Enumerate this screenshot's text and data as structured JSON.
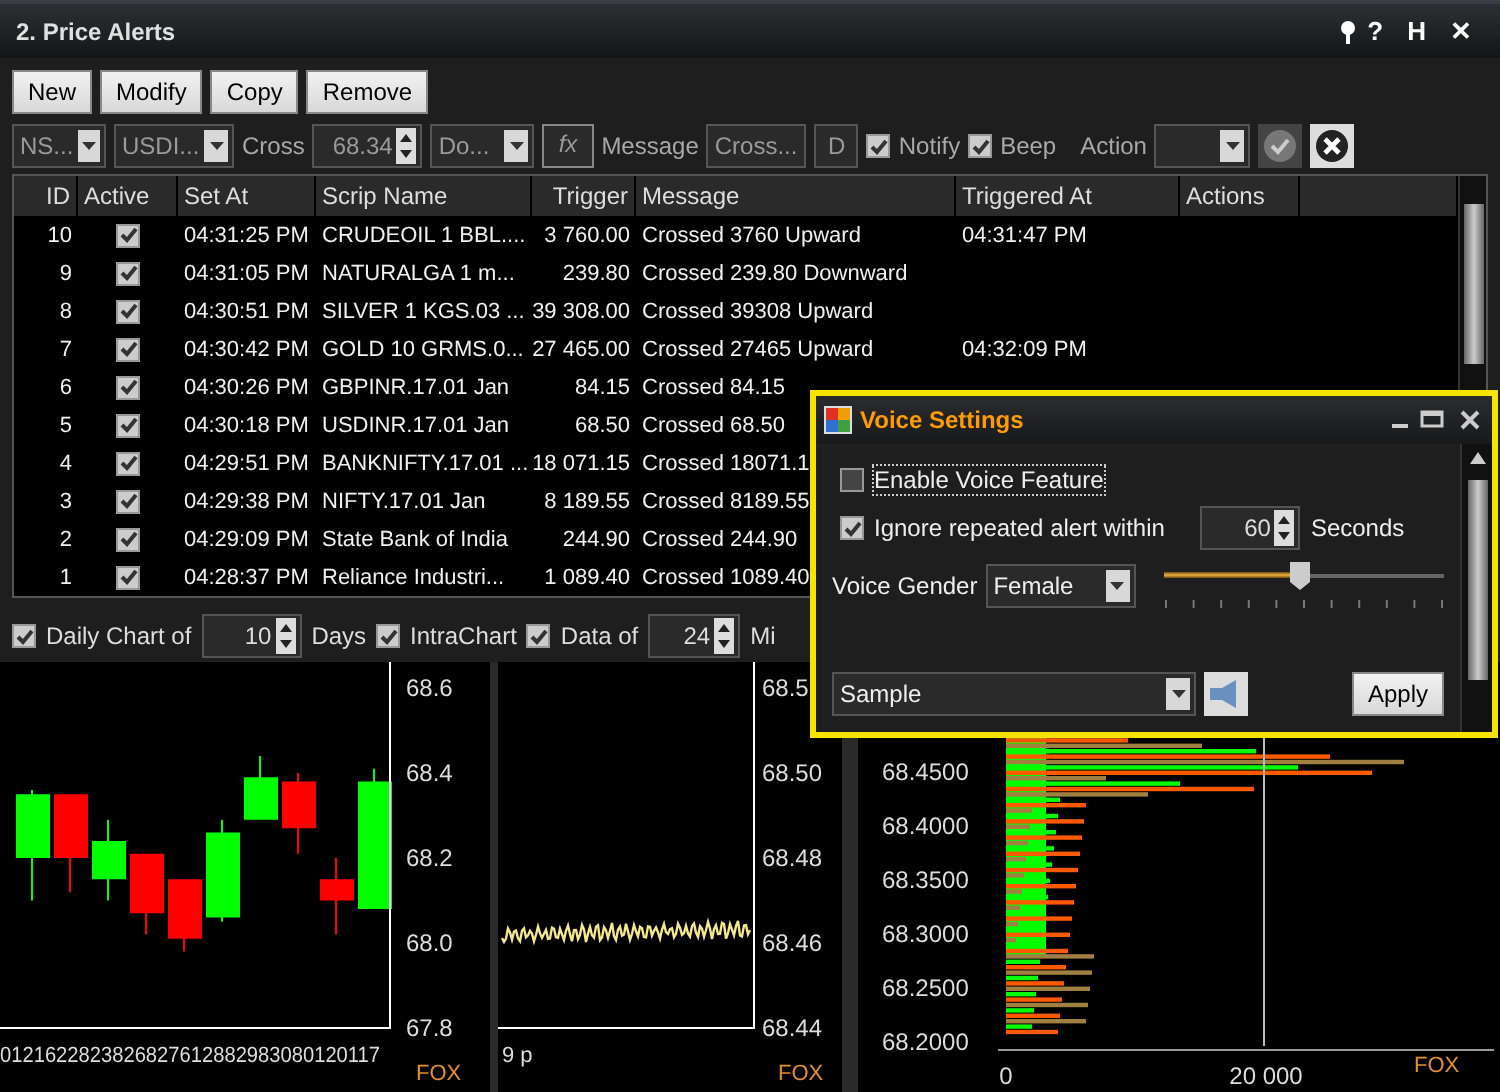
{
  "window": {
    "title": "2. Price Alerts",
    "title_buttons": [
      "?",
      "H",
      "✕"
    ]
  },
  "toolbar": {
    "buttons": [
      "New",
      "Modify",
      "Copy",
      "Remove"
    ]
  },
  "filter": {
    "exchange": "NS...",
    "symbol": "USDI...",
    "condition": "Cross",
    "price": "68.34",
    "direction": "Do...",
    "fx": "fx",
    "message_label": "Message",
    "message": "Cross...",
    "d": "D",
    "notify": {
      "label": "Notify",
      "checked": true
    },
    "beep": {
      "label": "Beep",
      "checked": true
    },
    "action_label": "Action"
  },
  "table": {
    "columns": [
      "ID",
      "Active",
      "Set At",
      "Scrip Name",
      "Trigger",
      "Message",
      "Triggered At",
      "Actions"
    ],
    "rows": [
      {
        "id": "10",
        "active": true,
        "set_at": "04:31:25 PM",
        "scrip": "CRUDEOIL 1 BBL....",
        "trigger": "3 760.00",
        "message": "Crossed 3760 Upward",
        "triggered_at": "04:31:47 PM"
      },
      {
        "id": "9",
        "active": true,
        "set_at": "04:31:05 PM",
        "scrip": "NATURALGA 1 m...",
        "trigger": "239.80",
        "message": "Crossed 239.80 Downward"
      },
      {
        "id": "8",
        "active": true,
        "set_at": "04:30:51 PM",
        "scrip": "SILVER 1 KGS.03 ...",
        "trigger": "39 308.00",
        "message": "Crossed 39308 Upward"
      },
      {
        "id": "7",
        "active": true,
        "set_at": "04:30:42 PM",
        "scrip": "GOLD 10 GRMS.0...",
        "trigger": "27 465.00",
        "message": "Crossed 27465 Upward",
        "triggered_at": "04:32:09 PM"
      },
      {
        "id": "6",
        "active": true,
        "set_at": "04:30:26 PM",
        "scrip": "GBPINR.17.01 Jan",
        "trigger": "84.15",
        "message": "Crossed 84.15"
      },
      {
        "id": "5",
        "active": true,
        "set_at": "04:30:18 PM",
        "scrip": "USDINR.17.01 Jan",
        "trigger": "68.50",
        "message": "Crossed 68.50"
      },
      {
        "id": "4",
        "active": true,
        "set_at": "04:29:51 PM",
        "scrip": "BANKNIFTY.17.01 ...",
        "trigger": "18 071.15",
        "message": "Crossed 18071.1"
      },
      {
        "id": "3",
        "active": true,
        "set_at": "04:29:38 PM",
        "scrip": "NIFTY.17.01 Jan",
        "trigger": "8 189.55",
        "message": "Crossed 8189.55"
      },
      {
        "id": "2",
        "active": true,
        "set_at": "04:29:09 PM",
        "scrip": "State Bank of India",
        "trigger": "244.90",
        "message": "Crossed 244.90"
      },
      {
        "id": "1",
        "active": true,
        "set_at": "04:28:37 PM",
        "scrip": "Reliance Industri...",
        "trigger": "1 089.40",
        "message": "Crossed 1089.40"
      }
    ]
  },
  "chart_options": {
    "daily": {
      "label": "Daily Chart of",
      "checked": true,
      "value": "10",
      "unit": "Days"
    },
    "intra": {
      "label": "IntraChart",
      "checked": true
    },
    "data": {
      "label": "Data of",
      "checked": true,
      "value": "24",
      "unit": "Mi"
    }
  },
  "daily_chart": {
    "yticks": [
      "68.6",
      "68.4",
      "68.2",
      "68.0",
      "67.8"
    ],
    "xlabels": "0121622823826827612882983080120117",
    "source": "FOX"
  },
  "intra_chart": {
    "yticks": [
      "68.5",
      "68.50",
      "68.48",
      "68.46",
      "68.44"
    ],
    "xlabels": "9 p",
    "source": "FOX"
  },
  "volume_chart": {
    "yticks": [
      "68.4500",
      "68.4000",
      "68.3500",
      "68.3000",
      "68.2500",
      "68.2000"
    ],
    "xticks": [
      "0",
      "20 000"
    ],
    "source": "FOX"
  },
  "voice_dialog": {
    "title": "Voice Settings",
    "enable": {
      "label": "Enable Voice Feature",
      "checked": false
    },
    "ignore": {
      "label": "Ignore repeated alert within",
      "checked": true,
      "value": "60",
      "unit": "Seconds"
    },
    "gender_label": "Voice Gender",
    "gender": "Female",
    "speed": {
      "level": 0.49
    },
    "sample": "Sample",
    "apply": "Apply"
  }
}
